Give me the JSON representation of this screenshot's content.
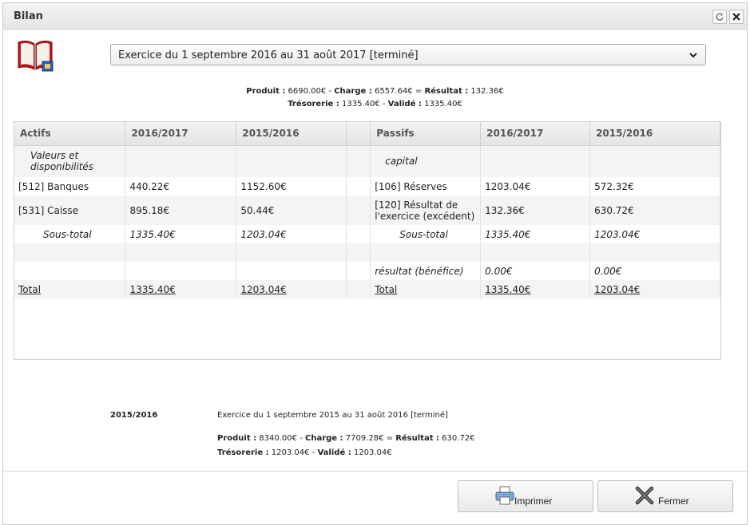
{
  "window": {
    "title": "Bilan"
  },
  "exercise_select": {
    "value": "Exercice du 1 septembre 2016 au 31 août 2017 [terminé]"
  },
  "summary": {
    "produit_label": "Produit :",
    "produit": "6690.00€",
    "charge_label": "Charge :",
    "charge": "6557.64€",
    "resultat_label": "Résultat :",
    "resultat": "132.36€",
    "tresorerie_label": "Trésorerie :",
    "tresorerie": "1335.40€",
    "valide_label": "Validé :",
    "valide": "1335.40€"
  },
  "table": {
    "headers": [
      "Actifs",
      "2016/2017",
      "2015/2016",
      "",
      "Passifs",
      "2016/2017",
      "2015/2016"
    ],
    "rows": [
      [
        "Valeurs et disponibilités",
        "",
        "",
        "",
        "capital",
        "",
        ""
      ],
      [
        "[512] Banques",
        "440.22€",
        "1152.60€",
        "",
        "[106] Réserves",
        "1203.04€",
        "572.32€"
      ],
      [
        "[531] Caisse",
        "895.18€",
        "50.44€",
        "",
        "[120] Résultat de l'exercice (excédent)",
        "132.36€",
        "630.72€"
      ],
      [
        "Sous-total",
        "1335.40€",
        "1203.04€",
        "",
        "Sous-total",
        "1335.40€",
        "1203.04€"
      ],
      [
        "",
        "",
        "",
        "",
        "",
        "",
        ""
      ],
      [
        "",
        "",
        "",
        "",
        "résultat (bénéfice)",
        "0.00€",
        "0.00€"
      ],
      [
        "Total",
        "1335.40€",
        "1203.04€",
        "",
        "Total",
        "1335.40€",
        "1203.04€"
      ]
    ]
  },
  "previous": {
    "year": "2015/2016",
    "label": "Exercice du 1 septembre 2015 au 31 août 2016 [terminé]",
    "produit_label": "Produit :",
    "produit": "8340.00€",
    "charge_label": "Charge :",
    "charge": "7709.28€",
    "resultat_label": "Résultat :",
    "resultat": "630.72€",
    "tresorerie_label": "Trésorerie :",
    "tresorerie": "1203.04€",
    "valide_label": "Validé :",
    "valide": "1203.04€"
  },
  "buttons": {
    "print": "Imprimer",
    "close": "Fermer"
  },
  "icons": {
    "book": "book-icon",
    "refresh": "refresh-icon",
    "close": "close-icon",
    "caret": "chevron-down-icon",
    "printer": "printer-icon",
    "cross": "cross-icon"
  },
  "colors": {
    "book_red": "#c0161c",
    "accent_blue": "#2a5db0"
  }
}
